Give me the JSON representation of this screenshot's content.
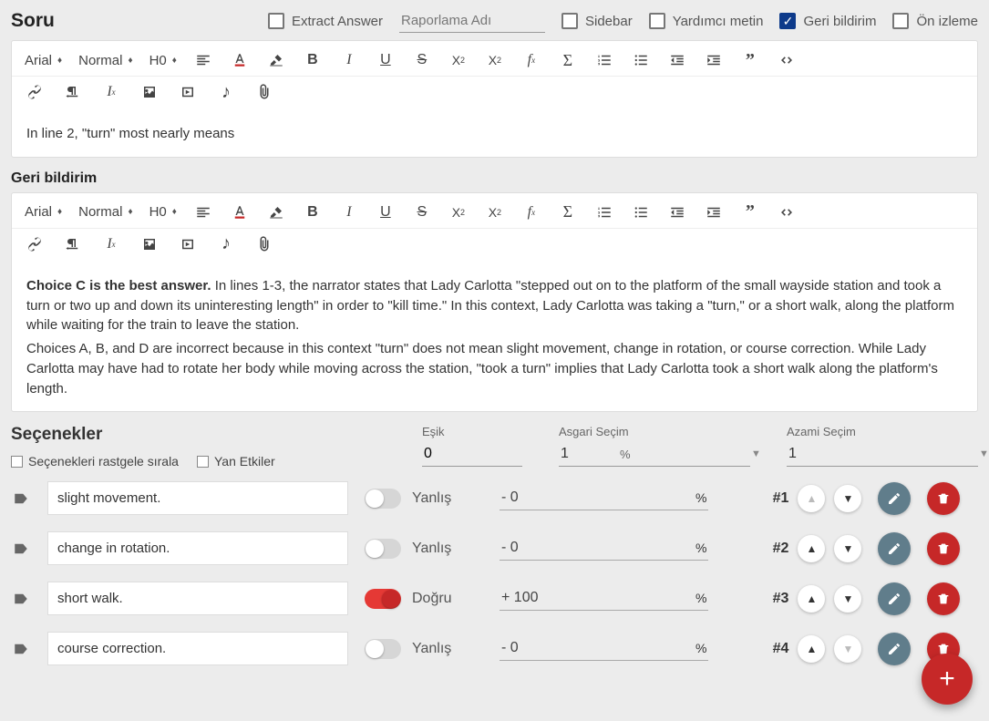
{
  "header": {
    "title": "Soru",
    "extract_answer": "Extract Answer",
    "report_name_placeholder": "Raporlama Adı",
    "sidebar": "Sidebar",
    "helper_text": "Yardımcı metin",
    "feedback": "Geri bildirim",
    "preview": "Ön izleme"
  },
  "toolbar": {
    "font": "Arial",
    "weight": "Normal",
    "heading": "H0"
  },
  "question_text": "In line 2, \"turn\" most nearly means",
  "feedback_label": "Geri bildirim",
  "feedback_bold": "Choice C is the best answer.",
  "feedback_rest": " In lines 1-3, the narrator states that Lady Carlotta \"stepped out on to the platform of the small wayside station and took a turn or two up and down its uninteresting length\" in order to \"kill time.\" In this context, Lady Carlotta was taking a \"turn,\" or a short walk, along the platform while waiting for the train to leave the station.",
  "feedback_p2": "Choices A, B, and D are incorrect because in this context \"turn\" does not mean slight movement, change in rotation, or course correction. While Lady Carlotta may have had to rotate her body while moving across the station, \"took a turn\" implies that Lady Carlotta took a short walk along the platform's length.",
  "options": {
    "title": "Seçenekler",
    "randomize": "Seçenekleri rastgele sırala",
    "side_effects": "Yan Etkiler",
    "threshold_label": "Eşik",
    "threshold_value": "0",
    "min_label": "Asgari Seçim",
    "min_value": "1",
    "max_label": "Azami Seçim",
    "max_value": "1",
    "pct": "%"
  },
  "labels": {
    "wrong": "Yanlış",
    "right": "Doğru",
    "pct": "%"
  },
  "choices": [
    {
      "text": "slight movement.",
      "correct": false,
      "score": "- 0",
      "rank": "#1",
      "up_disabled": true,
      "down_disabled": false
    },
    {
      "text": "change in rotation.",
      "correct": false,
      "score": "- 0",
      "rank": "#2",
      "up_disabled": false,
      "down_disabled": false
    },
    {
      "text": "short walk.",
      "correct": true,
      "score": "+ 100",
      "rank": "#3",
      "up_disabled": false,
      "down_disabled": false
    },
    {
      "text": "course correction.",
      "correct": false,
      "score": "- 0",
      "rank": "#4",
      "up_disabled": false,
      "down_disabled": true
    }
  ]
}
